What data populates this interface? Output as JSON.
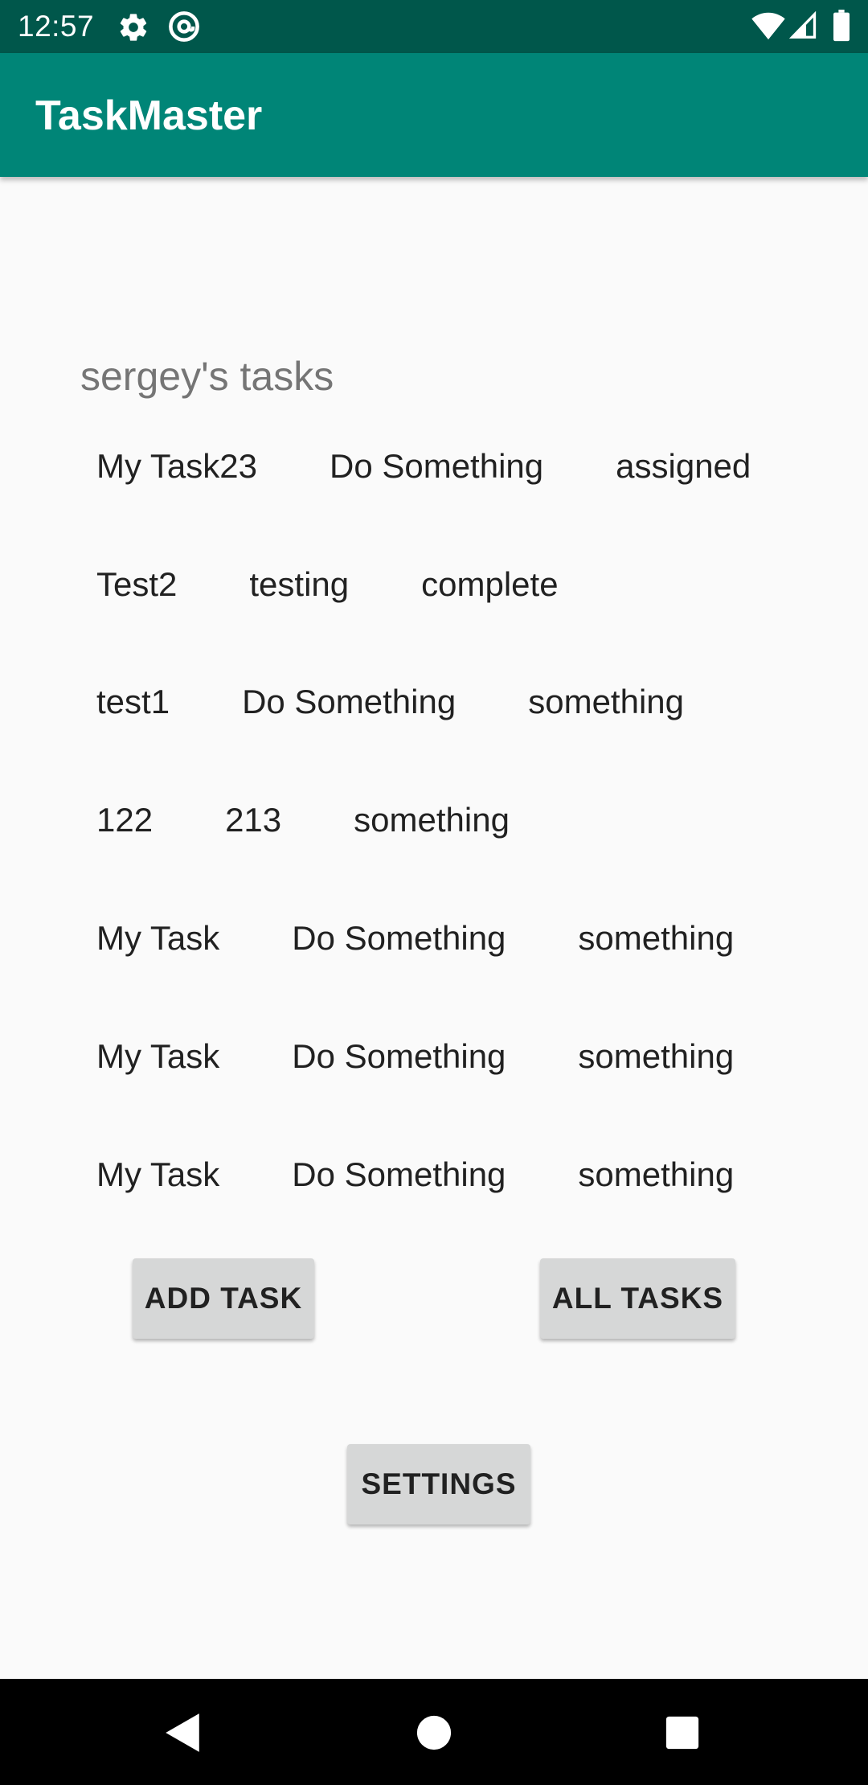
{
  "status_bar": {
    "time": "12:57",
    "icons": [
      "gear-icon",
      "at-sign-icon",
      "wifi-icon",
      "cell-signal-icon",
      "battery-icon"
    ]
  },
  "app_bar": {
    "title": "TaskMaster",
    "color": "#008577"
  },
  "main": {
    "heading": "sergey's tasks",
    "tasks": [
      {
        "title": "My Task23",
        "body": "Do Something",
        "state": "assigned"
      },
      {
        "title": "Test2",
        "body": "testing",
        "state": "complete"
      },
      {
        "title": "test1",
        "body": "Do Something",
        "state": "something"
      },
      {
        "title": "122",
        "body": "213",
        "state": "something"
      },
      {
        "title": "My Task",
        "body": "Do Something",
        "state": "something"
      },
      {
        "title": "My Task",
        "body": "Do Something",
        "state": "something"
      },
      {
        "title": "My Task",
        "body": "Do Something",
        "state": "something"
      }
    ],
    "buttons": {
      "add_task": "ADD TASK",
      "all_tasks": "ALL TASKS",
      "settings": "SETTINGS"
    }
  },
  "nav_bar": {
    "icons": [
      "back-icon",
      "home-icon",
      "recents-icon"
    ]
  }
}
